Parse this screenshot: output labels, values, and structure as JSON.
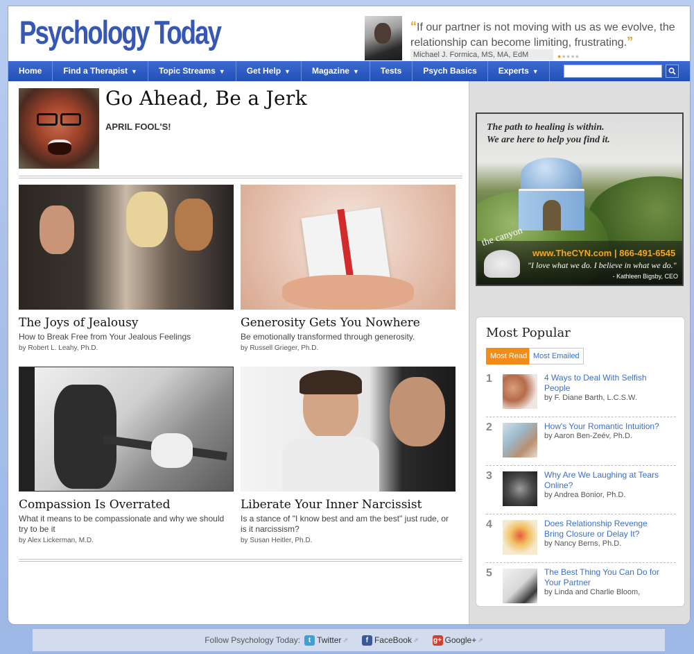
{
  "header": {
    "logo": "Psychology Today",
    "quote": {
      "text": "If our partner is not moving with us as we evolve, the relationship can become limiting, frustrating.",
      "open_mark": "“",
      "close_mark": "”",
      "author": "Michael J. Formica, MS, MA, EdM"
    }
  },
  "nav": {
    "items": [
      {
        "label": "Home",
        "dropdown": false
      },
      {
        "label": "Find a Therapist",
        "dropdown": true
      },
      {
        "label": "Topic Streams",
        "dropdown": true
      },
      {
        "label": "Get Help",
        "dropdown": true
      },
      {
        "label": "Magazine",
        "dropdown": true
      },
      {
        "label": "Tests",
        "dropdown": false
      },
      {
        "label": "Psych Basics",
        "dropdown": false
      },
      {
        "label": "Experts",
        "dropdown": true
      }
    ],
    "search_value": "",
    "search_icon": "magnifier-icon"
  },
  "hero": {
    "title": "Go Ahead, Be a Jerk",
    "kicker": "APRIL FOOL'S!"
  },
  "articles": [
    {
      "title": "The Joys of Jealousy",
      "subtitle": "How to Break Free from Your Jealous Feelings",
      "author": "by Robert L. Leahy, Ph.D."
    },
    {
      "title": "Generosity Gets You Nowhere",
      "subtitle": "Be emotionally transformed through generosity.",
      "author": "by Russell Grieger, Ph.D."
    },
    {
      "title": "Compassion Is Overrated",
      "subtitle": "What it means to be compassionate and why we should try to be it",
      "author": "by Alex Lickerman, M.D."
    },
    {
      "title": "Liberate Your Inner Narcissist",
      "subtitle": "Is a stance of \"I know best and am the best\" just rude, or is it narcissism?",
      "author": "by Susan Heitler, Ph.D."
    }
  ],
  "ad": {
    "line1": "The path to healing is within.",
    "line2": "We are here to help you find it.",
    "brand": "the canyon",
    "url_phone": "www.TheCYN.com | 866-491-6545",
    "slogan": "\"I love what we do. I believe in what we do.\"",
    "ceo": "- Kathleen Bigsby, CEO"
  },
  "most_popular": {
    "title": "Most Popular",
    "tabs": [
      "Most Read",
      "Most Emailed"
    ],
    "active_tab": "Most Read",
    "items": [
      {
        "rank": "1",
        "title": "4 Ways to Deal With Selfish People",
        "author": "by F. Diane Barth, L.C.S.W."
      },
      {
        "rank": "2",
        "title": "How's Your Romantic Intuition?",
        "author": "by Aaron Ben-Zeév, Ph.D."
      },
      {
        "rank": "3",
        "title": "Why Are We Laughing at Tears Online?",
        "author": "by Andrea Bonior, Ph.D."
      },
      {
        "rank": "4",
        "title": "Does Relationship Revenge Bring Closure or Delay It?",
        "author": "by Nancy Berns, Ph.D."
      },
      {
        "rank": "5",
        "title": "The Best Thing You Can Do for Your Partner",
        "author": "by Linda and Charlie Bloom,"
      }
    ]
  },
  "footer": {
    "follow_label": "Follow Psychology Today:",
    "links": [
      {
        "label": "Twitter",
        "icon": "twitter-icon",
        "color": "#3aa0d8",
        "glyph": "t"
      },
      {
        "label": "FaceBook",
        "icon": "facebook-icon",
        "color": "#3b5998",
        "glyph": "f"
      },
      {
        "label": "Google+",
        "icon": "google-plus-icon",
        "color": "#d23f2f",
        "glyph": "g+"
      }
    ]
  },
  "colors": {
    "brand_blue": "#3657b4",
    "nav_blue": "#2c5bc4",
    "accent_orange": "#f18c16",
    "link_blue": "#3b6fc6"
  }
}
